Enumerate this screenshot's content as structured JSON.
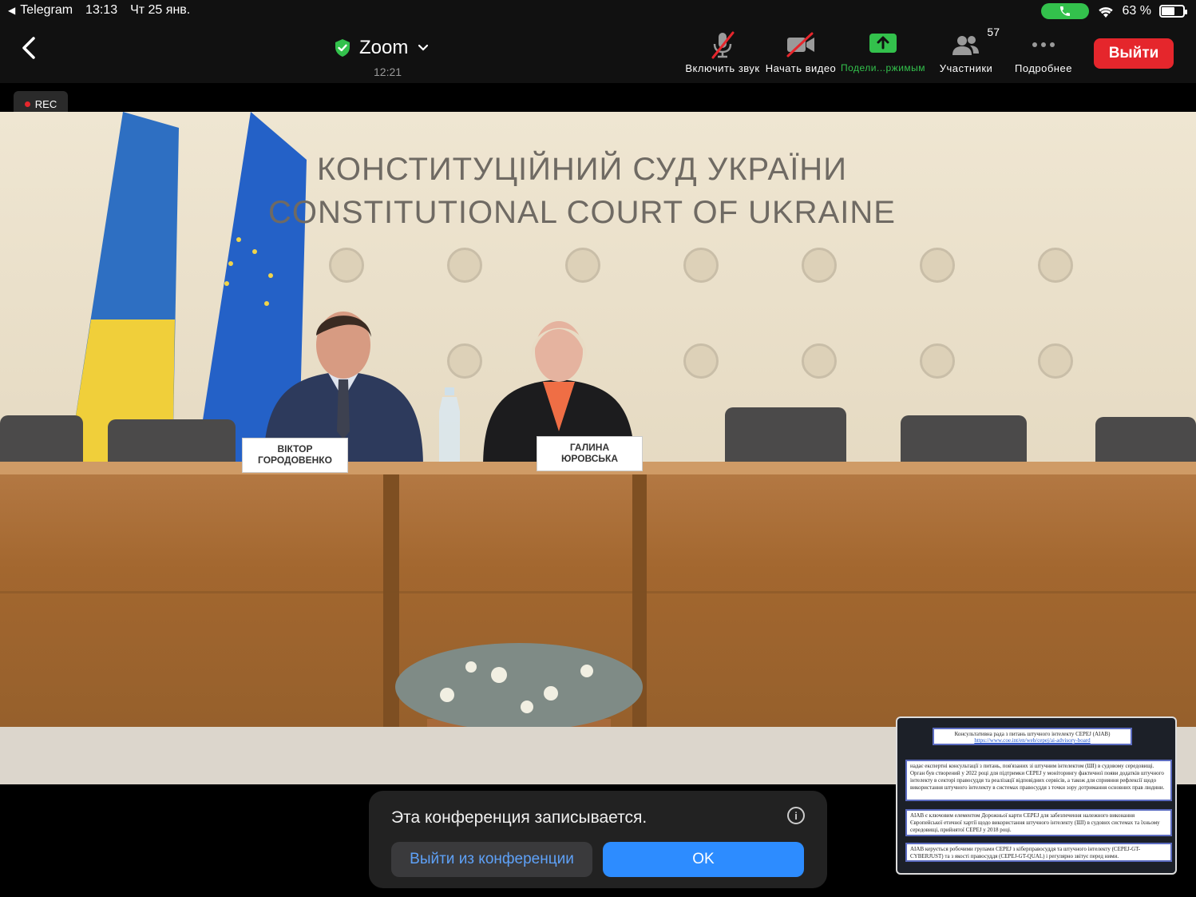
{
  "status_bar": {
    "back_app": "Telegram",
    "time": "13:13",
    "date": "Чт 25 янв.",
    "battery": "63 %",
    "battery_level": 0.63
  },
  "toolbar": {
    "app_name": "Zoom",
    "timer": "12:21",
    "buttons": {
      "audio": "Включить звук",
      "video": "Начать видео",
      "share": "Подели...ржимым",
      "participants": "Участники",
      "participants_count": "57",
      "more": "Подробнее"
    },
    "leave": "Выйти",
    "accent_green": "#33c14c",
    "leave_color": "#e5262c"
  },
  "rec_badge": "REC",
  "video": {
    "title_line1": "КОНСТИТУЦІЙНИЙ СУД УКРАЇНИ",
    "title_line2": "CONSTITUTIONAL COURT OF UKRAINE",
    "nameplate_left": [
      "ВІКТОР",
      "ГОРОДОВЕНКО"
    ],
    "nameplate_right": [
      "ГАЛИНА",
      "ЮРОВСЬКА"
    ]
  },
  "thumbnail": {
    "heading": "Консультативна рада з питань штучного інтелекту CEPEJ (AIAB)",
    "link": "https://www.coe.int/en/web/cepej/ai-advisory-board",
    "para1": "надає експертні консультації з питань, пов'язаних зі штучним інтелектом (ШІ) в судовому середовищі. Орган був створений у 2022 році для підтримки CEPEJ у моніторингу фактичної появи додатків штучного інтелекту в секторі правосуддя та реалізації відповідних сервісів, а також для сприяння рефлексії щодо використання штучного інтелекту в системах правосуддя з точки зору дотримання основних прав людини.",
    "para2": "AIAB є ключовим елементом Дорожньої карти CEPEJ для забезпечення належного виконання Європейської етичної хартії щодо використання штучного інтелекту (ШІ) в судових системах та їхньому середовищі, прийнятої CEPEJ у 2018 році.",
    "para3": "AIAB керується робочими групами CEPEJ з кіберправосуддя та штучного інтелекту (CEPEJ-GT-CYBERJUST) та з якості правосуддя (CEPEJ-GT-QUAL) і регулярно звітує перед ними."
  },
  "recording_notice": {
    "message": "Эта конференция записывается.",
    "leave_button": "Выйти из конференции",
    "ok_button": "OK"
  }
}
